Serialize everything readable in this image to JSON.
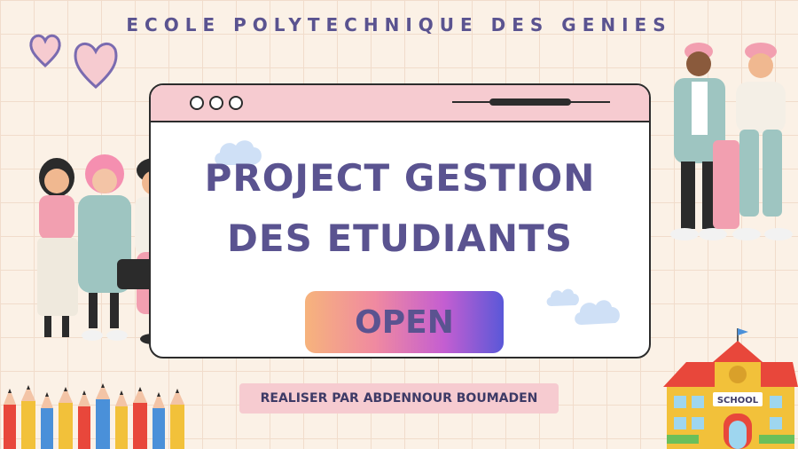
{
  "header": {
    "school_name": "ECOLE POLYTECHNIQUE DES GENIES"
  },
  "window": {
    "title_line1": "PROJECT GESTION",
    "title_line2": "DES ETUDIANTS",
    "open_label": "OPEN"
  },
  "footer": {
    "credit": "REALISER PAR ABDENNOUR BOUMADEN"
  },
  "building": {
    "sign": "SCHOOL"
  },
  "colors": {
    "accent": "#5a5390",
    "titlebar": "#f6cbd0",
    "background": "#fbf1e6"
  },
  "icons": [
    "heart-icon",
    "cloud-icon",
    "pencil-icon",
    "school-building-icon"
  ]
}
